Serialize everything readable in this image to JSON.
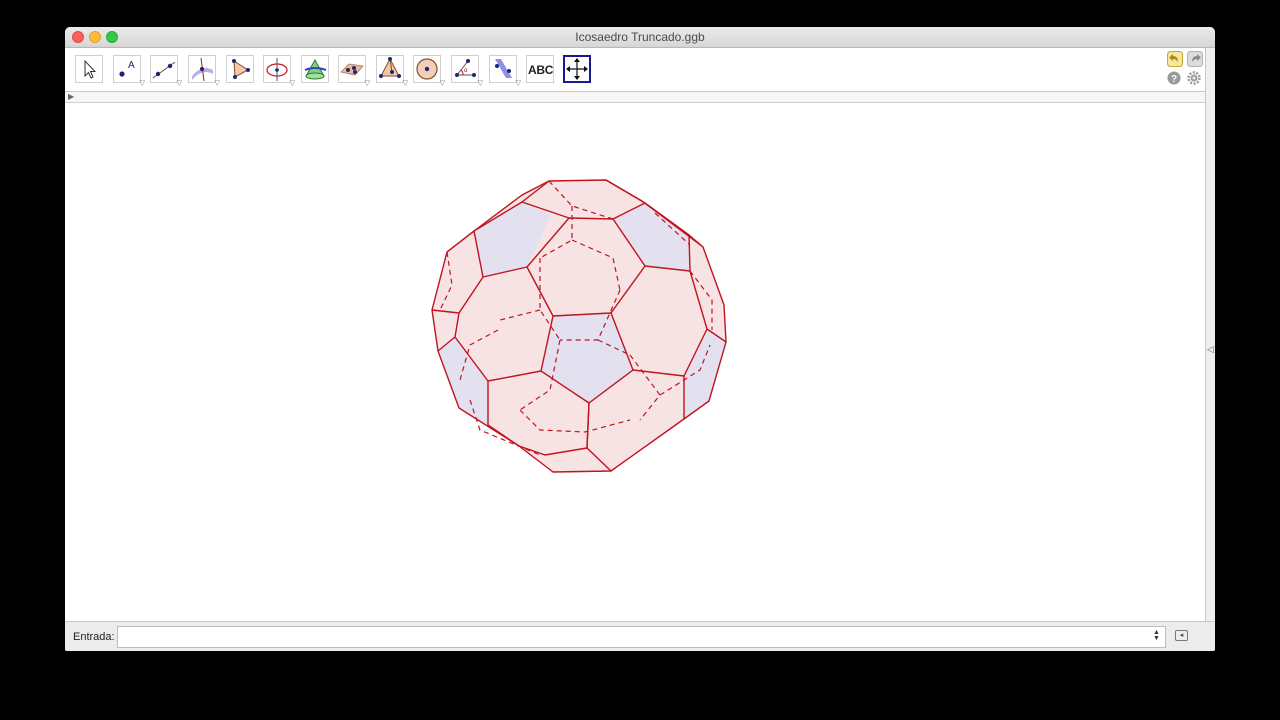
{
  "window": {
    "title": "Icosaedro Truncado.ggb"
  },
  "toolbar": {
    "tools": [
      {
        "name": "move-tool"
      },
      {
        "name": "point-tool"
      },
      {
        "name": "line-tool"
      },
      {
        "name": "perpendicular-line-tool"
      },
      {
        "name": "polygon-tool"
      },
      {
        "name": "circle-axis-tool"
      },
      {
        "name": "intersect-surfaces-tool"
      },
      {
        "name": "plane-tool"
      },
      {
        "name": "pyramid-tool"
      },
      {
        "name": "sphere-tool"
      },
      {
        "name": "angle-tool"
      },
      {
        "name": "reflect-tool"
      },
      {
        "name": "text-tool",
        "label": "ABC"
      },
      {
        "name": "move-graphics-view-tool"
      }
    ],
    "undo_icon": "undo-icon",
    "redo_icon": "redo-icon",
    "help_icon": "help-icon",
    "settings_icon": "gear-icon"
  },
  "graphics": {
    "object": "truncated-icosahedron",
    "edge_color": "#c0141e",
    "hexagon_fill": "#f6dede",
    "pentagon_fill": "#dfe0f2"
  },
  "input_bar": {
    "label": "Entrada:",
    "value": "",
    "placeholder": ""
  }
}
